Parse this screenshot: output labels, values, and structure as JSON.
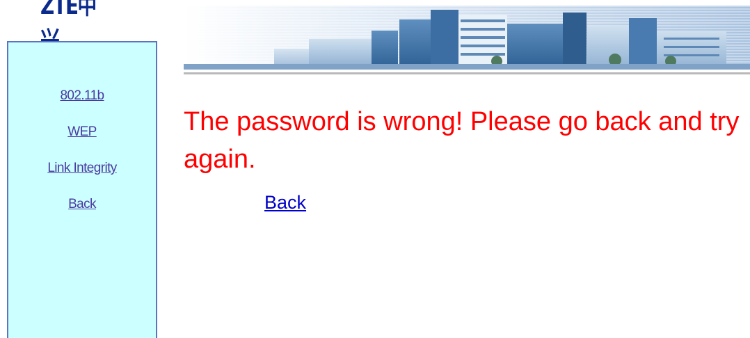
{
  "brand": {
    "logo_text": "ZTE中兴"
  },
  "sidebar": {
    "items": [
      {
        "label": "802.11b"
      },
      {
        "label": "WEP"
      },
      {
        "label": "Link Integrity"
      },
      {
        "label": "Back"
      }
    ]
  },
  "main": {
    "error_message": "The password is wrong! Please go back and try again.",
    "back_link_label": "Back"
  },
  "colors": {
    "sidebar_bg": "#ccffff",
    "sidebar_border": "#5a74c2",
    "error_text": "#ff0000",
    "link": "#0000cc",
    "logo": "#0a2a8c"
  }
}
